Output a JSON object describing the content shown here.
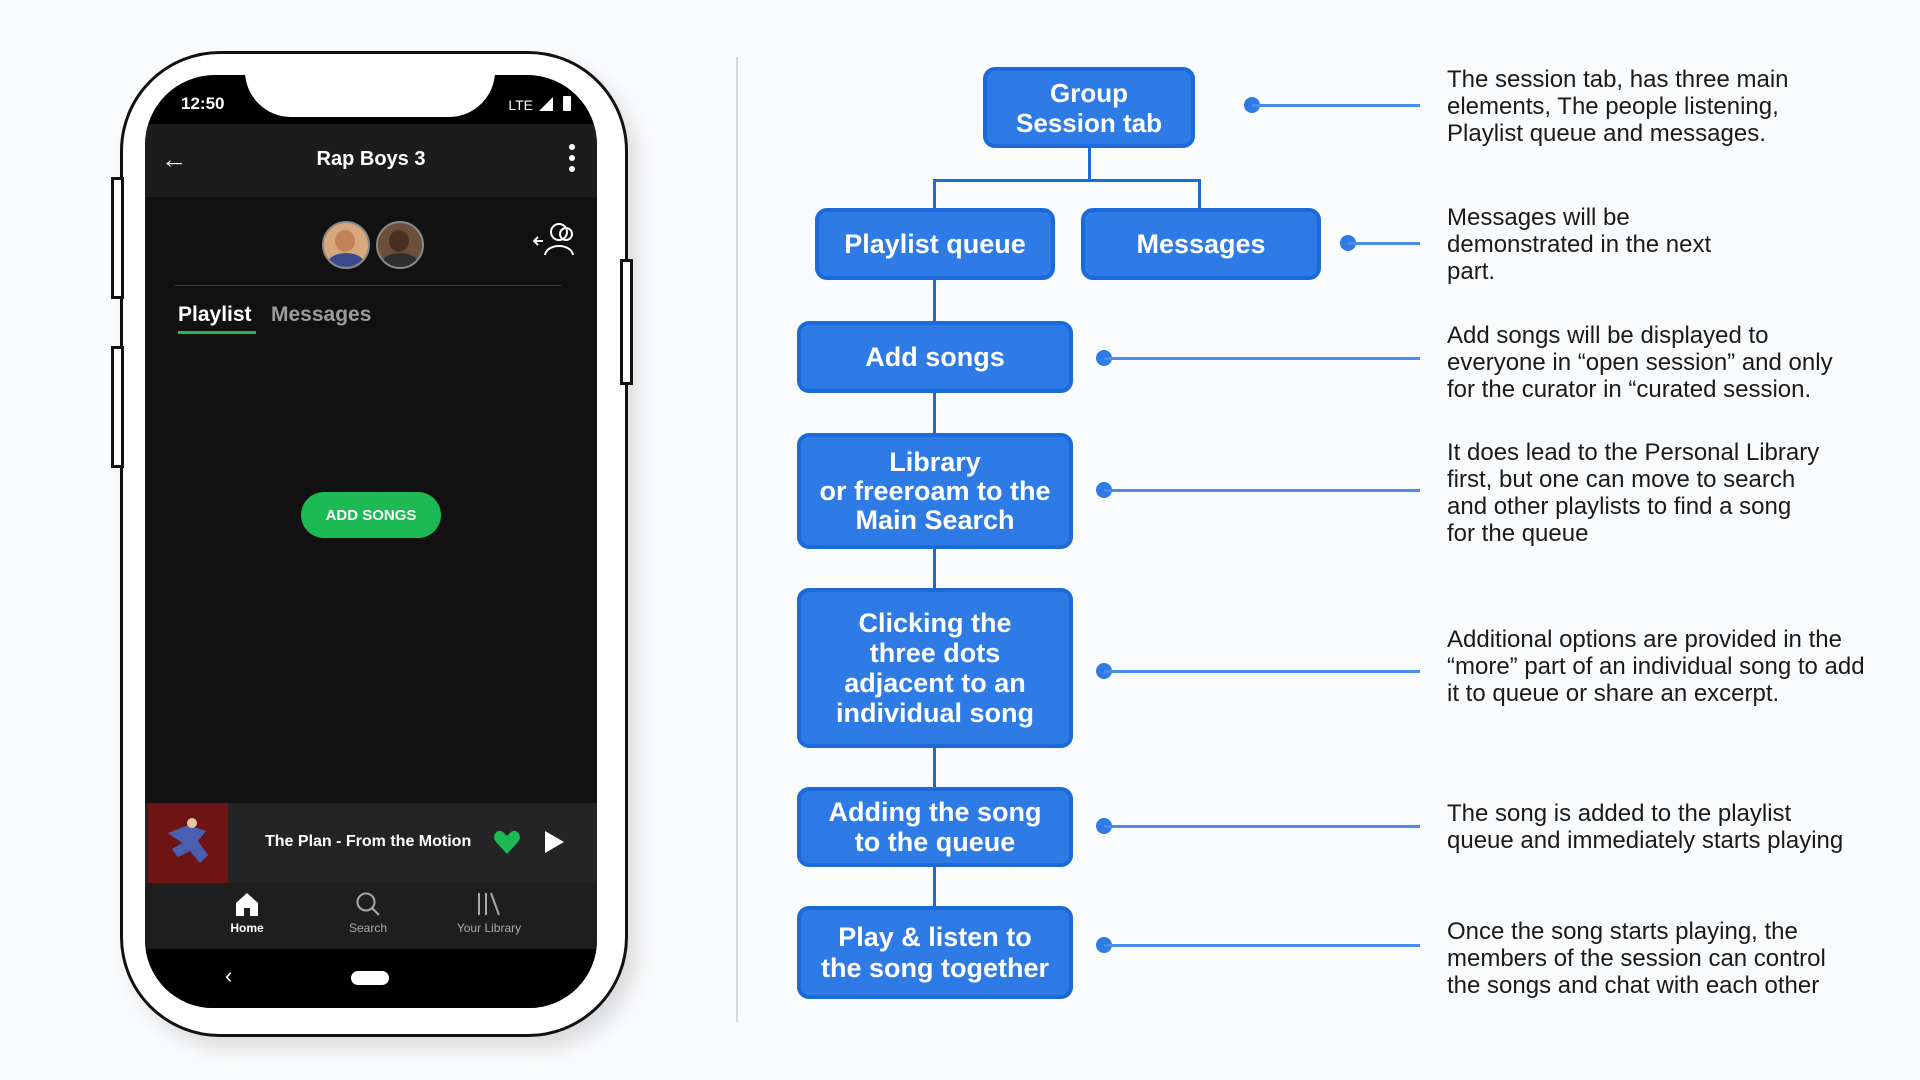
{
  "phone": {
    "status_time": "12:50",
    "status_network": "LTE",
    "header": {
      "title": "Rap Boys 3"
    },
    "tabs": {
      "playlist": "Playlist",
      "messages": "Messages"
    },
    "add_songs_button": "ADD SONGS",
    "now_playing": {
      "title": "The Plan - From the Motion"
    },
    "nav": {
      "home": "Home",
      "search": "Search",
      "library": "Your Library"
    },
    "icons": [
      "back-arrow-icon",
      "more-vert-icon",
      "add-people-icon",
      "heart-icon",
      "play-icon",
      "home-icon",
      "search-icon",
      "library-icon"
    ],
    "colors": {
      "accent": "#1db954",
      "background": "#111111"
    }
  },
  "diagram": {
    "nodes": {
      "group": "Group\nSession tab",
      "playlist_queue": "Playlist queue",
      "messages": "Messages",
      "add_songs": "Add songs",
      "library": "Library\nor freeroam to the\nMain Search",
      "three_dots": "Clicking the\nthree dots\nadjacent to an\nindividual song",
      "adding": "Adding the song\nto the queue",
      "play": "Play & listen to\nthe song together"
    },
    "notes": {
      "group": "The session tab, has three main\nelements, The people listening,\nPlaylist queue and messages.",
      "messages": "Messages will be\ndemonstrated in the next\npart.",
      "add_songs": "Add songs will be displayed to\neveryone in “open session” and only\nfor the curator in “curated session.",
      "library": "It does lead to the Personal Library\nfirst, but one can move to search\nand other playlists to find a song\nfor the queue",
      "three_dots": "Additional options are provided in the\n“more” part of an individual song to add\nit to queue or share an excerpt.",
      "adding": "The song is added to the playlist\nqueue and immediately starts playing",
      "play": "Once the song starts playing, the\nmembers of the session can control\nthe songs and chat with each other"
    },
    "colors": {
      "node": "#2f7be5",
      "node_border": "#1a6ad9"
    }
  }
}
